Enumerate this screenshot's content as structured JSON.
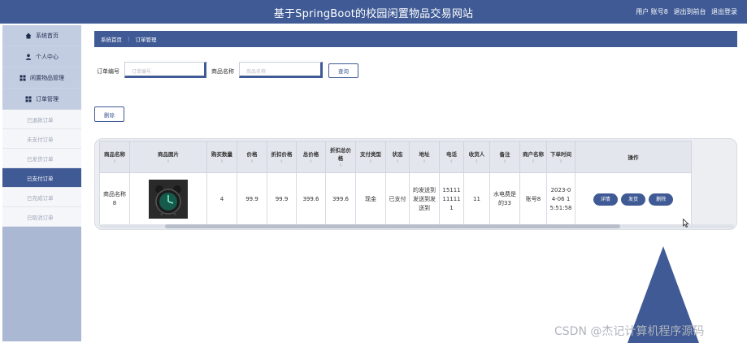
{
  "header": {
    "title": "基于SpringBoot的校园闲置物品交易网站",
    "user_label": "用户 账号8",
    "back_label": "退出到前台",
    "logout_label": "退出登录"
  },
  "sidebar": {
    "items": [
      {
        "label": "系统首页",
        "icon": "home-icon"
      },
      {
        "label": "个人中心",
        "icon": "person-icon"
      },
      {
        "label": "闲置物品管理",
        "icon": "grid-icon"
      },
      {
        "label": "订单管理",
        "icon": "grid-icon"
      }
    ],
    "sub_items": [
      {
        "label": "已退款订单"
      },
      {
        "label": "未支付订单"
      },
      {
        "label": "已发货订单"
      },
      {
        "label": "已支付订单",
        "active": true
      },
      {
        "label": "已完成订单"
      },
      {
        "label": "已取消订单"
      }
    ]
  },
  "breadcrumb": {
    "home": "系统首页",
    "separator": "⋮",
    "current": "订单管理"
  },
  "filters": {
    "order_no_label": "订单编号",
    "order_no_placeholder": "订单编号",
    "goods_name_label": "商品名称",
    "goods_name_placeholder": "商品名称",
    "query_button": "查询"
  },
  "actions": {
    "delete_button": "删除"
  },
  "table": {
    "columns": [
      "商品名称",
      "商品图片",
      "购买数量",
      "价格",
      "折扣价格",
      "总价格",
      "折扣总价格",
      "支付类型",
      "状态",
      "地址",
      "电话",
      "收货人",
      "备注",
      "商户名称",
      "下单时间",
      "操作"
    ],
    "sort_glyph": "⇕",
    "rows": [
      {
        "goods_name": "商品名称8",
        "quantity": "4",
        "price": "99.9",
        "discount_price": "99.9",
        "total": "399.6",
        "discount_total": "399.6",
        "pay_type": "现金",
        "status": "已支付",
        "address": "的发送到发送到发送到",
        "phone": "15111111111",
        "receiver": "11",
        "remark": "水电费是的33",
        "merchant": "账号8",
        "order_time": "2023-04-06 15:51:58",
        "btn_detail": "详情",
        "btn_ship": "发货",
        "btn_delete": "删除"
      }
    ]
  },
  "watermark": "CSDN @杰记计算机程序源码",
  "colors": {
    "primary": "#3f5a95",
    "sidebar": "#aab8d4",
    "menu": "#c3cde2"
  }
}
